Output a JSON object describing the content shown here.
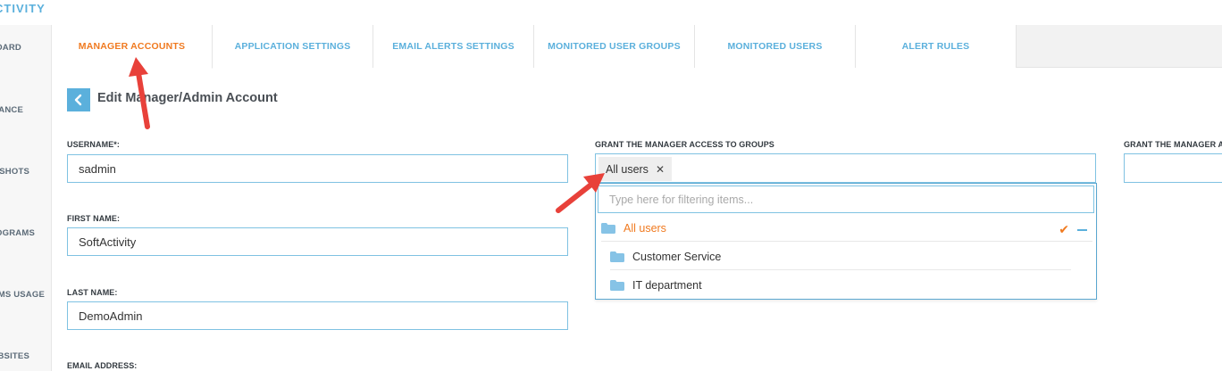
{
  "app": {
    "title": "CTIVITY"
  },
  "sidebar": {
    "items": [
      {
        "label": "OARD"
      },
      {
        "label": "DANCE"
      },
      {
        "label": "NSHOTS"
      },
      {
        "label": "ROGRAMS"
      },
      {
        "label": "AMS USAGE"
      },
      {
        "label": "EBSITES"
      }
    ]
  },
  "tabs": [
    {
      "label": "MANAGER ACCOUNTS",
      "active": true
    },
    {
      "label": "APPLICATION SETTINGS"
    },
    {
      "label": "EMAIL ALERTS SETTINGS"
    },
    {
      "label": "MONITORED USER GROUPS"
    },
    {
      "label": "MONITORED USERS"
    },
    {
      "label": "ALERT RULES"
    }
  ],
  "page": {
    "title": "Edit Manager/Admin Account"
  },
  "form": {
    "username": {
      "label": "USERNAME*:",
      "value": "sadmin"
    },
    "first_name": {
      "label": "FIRST NAME:",
      "value": "SoftActivity"
    },
    "last_name": {
      "label": "LAST NAME:",
      "value": "DemoAdmin"
    },
    "email": {
      "label": "EMAIL ADDRESS:"
    }
  },
  "groups": {
    "label": "GRANT THE MANAGER ACCESS TO GROUPS",
    "selected": [
      "All users"
    ],
    "filter_placeholder": "Type here for filtering items...",
    "tree": [
      {
        "label": "All users",
        "checked": true
      },
      {
        "label": "Customer Service"
      },
      {
        "label": "IT department"
      }
    ]
  },
  "second_grant": {
    "label": "GRANT THE MANAGER ACC"
  },
  "colors": {
    "accent_blue": "#5bb0dc",
    "accent_orange": "#f07a20",
    "annotation_red": "#e8413a"
  },
  "icons": {
    "back": "chevron-left-icon",
    "remove_tag": "close-icon",
    "folder": "folder-icon",
    "checked": "check-icon",
    "collapse": "minus-icon"
  }
}
